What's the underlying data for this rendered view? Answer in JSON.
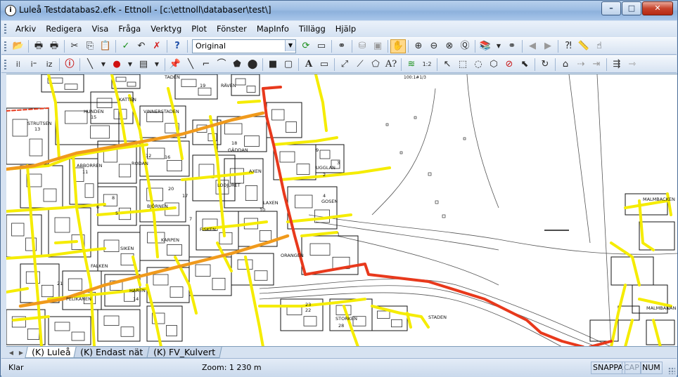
{
  "window": {
    "title": "Luleå Testdatabas2.efk - Ettnoll - [c:\\ettnoll\\databaser\\test\\]",
    "controls": {
      "minimize": "–",
      "maximize": "□",
      "close": "✕"
    }
  },
  "menu": [
    "Arkiv",
    "Redigera",
    "Visa",
    "Fråga",
    "Verktyg",
    "Plot",
    "Fönster",
    "MapInfo",
    "Tillägg",
    "Hjälp"
  ],
  "toolbar1": {
    "view_combo_value": "Original"
  },
  "map": {
    "labels": [
      "TADEN",
      "HUNDEN",
      "STRUTSEN",
      "VINNERSTADEN",
      "ABBORREN",
      "RODAN",
      "GÄDDAN",
      "AXEN",
      "GOSEN",
      "KARPEN",
      "SIKEN",
      "LAXEN",
      "HAREN",
      "PELIKANEN",
      "FALKEN",
      "MALMBANAN",
      "FISKEN",
      "ORANGEN",
      "STORKEN",
      "MALMBACKEN",
      "STADEN",
      "KATTEN",
      "RÄVEN",
      "BJÖRNEN",
      "UGGLAN",
      "LODJURET"
    ],
    "numbers": [
      "19",
      "15",
      "13",
      "11",
      "10",
      "12",
      "16",
      "20",
      "2",
      "9",
      "8",
      "6",
      "5",
      "3",
      "4",
      "14",
      "22",
      "28",
      "23",
      "1",
      "17",
      "18",
      "7",
      "21"
    ],
    "scale_note": "100:1#1/3",
    "colors": {
      "pipe_yellow": "#f5ec00",
      "pipe_orange": "#f09a1c",
      "pipe_red": "#e8391c",
      "building": "#000000"
    }
  },
  "tabs": [
    "(K) Luleå",
    "(K) Endast nät",
    "(K) FV_Kulvert"
  ],
  "status": {
    "ready": "Klar",
    "zoom": "Zoom: 1 230 m",
    "snap": "SNAPPA",
    "cap": "CAP",
    "num": "NUM"
  }
}
